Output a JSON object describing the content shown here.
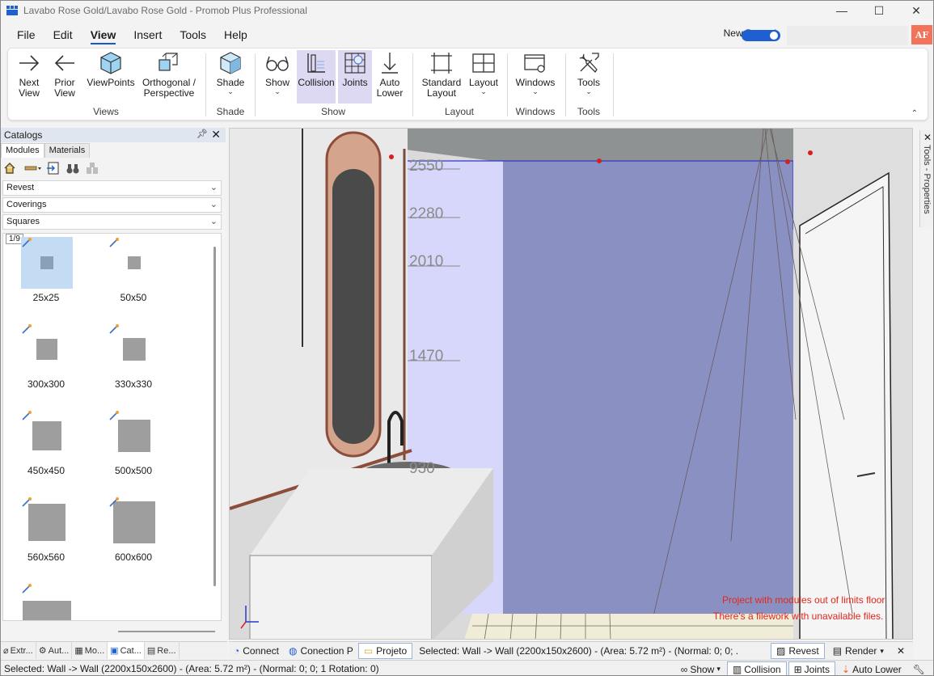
{
  "window": {
    "title": "Lavabo Rose Gold/Lavabo Rose Gold - Promob Plus Professional",
    "controls": [
      "—",
      "☐",
      "✕"
    ]
  },
  "menu": {
    "items": [
      "File",
      "Edit",
      "View",
      "Insert",
      "Tools",
      "Help"
    ],
    "active": "View",
    "new_promob_label": "New Promob",
    "avatar_initials": "AF"
  },
  "ribbon": {
    "buttons": {
      "next_view": "Next\nView",
      "prior_view": "Prior\nView",
      "viewpoints": "ViewPoints",
      "orthogonal": "Orthogonal /\nPerspective",
      "shade": "Shade",
      "show": "Show",
      "collision": "Collision",
      "joints": "Joints",
      "auto_lower": "Auto\nLower",
      "standard_layout": "Standard\nLayout",
      "layout": "Layout",
      "windows": "Windows",
      "tools": "Tools"
    },
    "groups": {
      "views": "Views",
      "shade": "Shade",
      "show": "Show",
      "layout": "Layout",
      "windows": "Windows",
      "tools": "Tools"
    },
    "accent_color": "#ddd9f3"
  },
  "catalogs": {
    "title": "Catalogs",
    "tabs": [
      "Modules",
      "Materials"
    ],
    "active_tab": "Modules",
    "dropdowns": [
      "Revest",
      "Coverings",
      "Squares"
    ],
    "page_indicator": "1/9",
    "items": [
      {
        "label": "25x25",
        "selected": true
      },
      {
        "label": "50x50",
        "selected": false
      },
      {
        "label": "300x300",
        "selected": false
      },
      {
        "label": "330x330",
        "selected": false
      },
      {
        "label": "450x450",
        "selected": false
      },
      {
        "label": "500x500",
        "selected": false
      },
      {
        "label": "560x560",
        "selected": false
      },
      {
        "label": "600x600",
        "selected": false
      },
      {
        "label": "",
        "selected": false
      }
    ],
    "bottom_tabs": [
      "Extr...",
      "Aut...",
      "Mo...",
      "Cat...",
      "Re..."
    ],
    "active_bottom_tab": "Cat..."
  },
  "viewport": {
    "dimension_labels": [
      "2550",
      "2280",
      "2010",
      "1470",
      "930"
    ],
    "warnings": [
      "Project with modules out of limits floor",
      "There's a filework with unavailable files."
    ],
    "wall_color": "#8a8fc0",
    "side_wall_color": "#d6d6fb",
    "warning_color": "#e0281c"
  },
  "side_panel": {
    "label": "Tools - Properties"
  },
  "viewport_bar": {
    "connect": "Connect",
    "conection": "Conection P",
    "projeto": "Projeto",
    "selection": "Selected: Wall -> Wall (2200x150x2600) - (Area: 5.72 m²) - (Normal: 0; 0; ...",
    "revest": "Revest",
    "render": "Render"
  },
  "statusbar": {
    "text": "Selected: Wall -> Wall (2200x150x2600) - (Area: 5.72 m²) - (Normal: 0; 0; 1 Rotation: 0)",
    "show": "Show",
    "collision": "Collision",
    "joints": "Joints",
    "auto_lower": "Auto Lower"
  }
}
